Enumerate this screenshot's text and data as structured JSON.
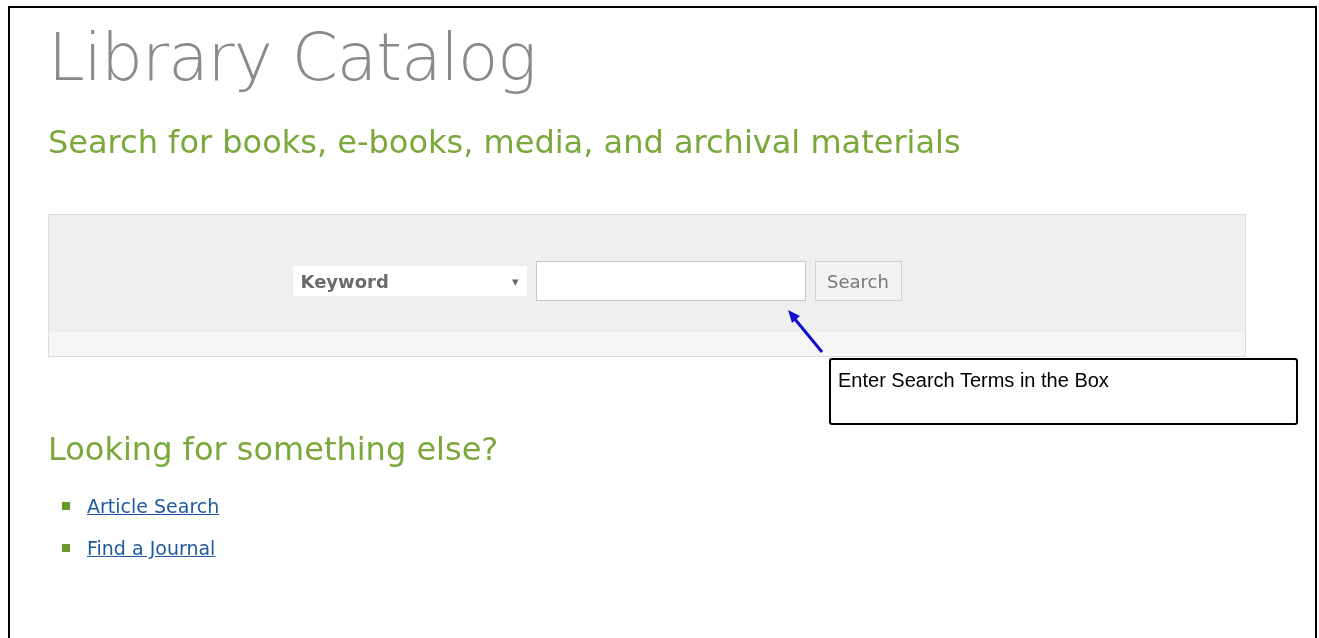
{
  "page": {
    "title": "Library Catalog",
    "subtitle": "Search for books, e-books, media, and archival materials"
  },
  "search": {
    "type_select": "Keyword",
    "caret": "▾",
    "button": "Search"
  },
  "callout": {
    "text": "Enter Search Terms in the Box"
  },
  "more": {
    "heading": "Looking for something else?",
    "links": [
      {
        "label": "Article Search"
      },
      {
        "label": "Find a Journal"
      }
    ]
  }
}
